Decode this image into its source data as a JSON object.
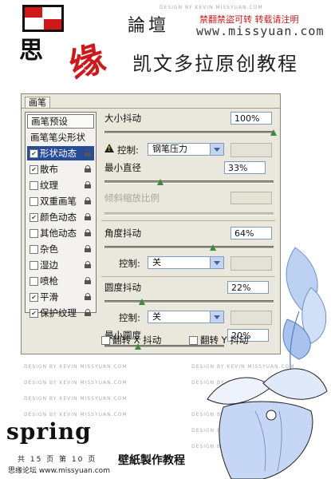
{
  "header": {
    "forum": "論壇",
    "notice": "禁翻禁盜可转 转载请注明",
    "site": "www.missyuan.com",
    "tutorial": "凯文多拉原创教程",
    "watermark": "DESIGN BY KEVIN MISSYUAN.COM"
  },
  "panel": {
    "tab": "画笔",
    "left_list": {
      "presets": "画笔预设",
      "tip_shape": "画笔笔尖形状",
      "items": [
        {
          "label": "形状动态",
          "checked": true,
          "selected": true,
          "locked": true
        },
        {
          "label": "散布",
          "checked": true,
          "selected": false,
          "locked": true
        },
        {
          "label": "纹理",
          "checked": false,
          "selected": false,
          "locked": true
        },
        {
          "label": "双重画笔",
          "checked": false,
          "selected": false,
          "locked": true
        },
        {
          "label": "颜色动态",
          "checked": true,
          "selected": false,
          "locked": true
        },
        {
          "label": "其他动态",
          "checked": false,
          "selected": false,
          "locked": true
        },
        {
          "label": "杂色",
          "checked": false,
          "selected": false,
          "locked": true
        },
        {
          "label": "湿边",
          "checked": false,
          "selected": false,
          "locked": true
        },
        {
          "label": "喷枪",
          "checked": false,
          "selected": false,
          "locked": true
        },
        {
          "label": "平滑",
          "checked": true,
          "selected": false,
          "locked": true
        },
        {
          "label": "保护纹理",
          "checked": true,
          "selected": false,
          "locked": true
        }
      ]
    },
    "size_jitter": {
      "label": "大小抖动",
      "value": "100%",
      "level": 1.0
    },
    "size_control": {
      "label": "控制:",
      "selected": "钢笔压力"
    },
    "min_diameter": {
      "label": "最小直径",
      "value": "33%",
      "level": 0.33
    },
    "tilt_scale": {
      "label": "倾斜缩放比例",
      "value": ""
    },
    "angle_jitter": {
      "label": "角度抖动",
      "value": "64%",
      "level": 0.64
    },
    "angle_control": {
      "label": "控制:",
      "selected": "关"
    },
    "roundness_jitter": {
      "label": "圆度抖动",
      "value": "22%",
      "level": 0.22
    },
    "roundness_control": {
      "label": "控制:",
      "selected": "关"
    },
    "min_roundness": {
      "label": "最小圆度",
      "value": "20%",
      "level": 0.2
    },
    "flip_x": {
      "label": "翻转 X 抖动",
      "checked": false
    },
    "flip_y": {
      "label": "翻转 Y 抖动",
      "checked": false
    }
  },
  "footer": {
    "spring": "spring",
    "page_info": "共 15 页 第 10 页",
    "wallpaper": "壁紙製作教程",
    "credit": "思缘论坛  www.missyuan.com"
  },
  "colors": {
    "selection": "#264c9a",
    "panel_bg": "#eae8dd",
    "accent_red": "#d01818",
    "flower_blue": "#a9c3ee"
  }
}
